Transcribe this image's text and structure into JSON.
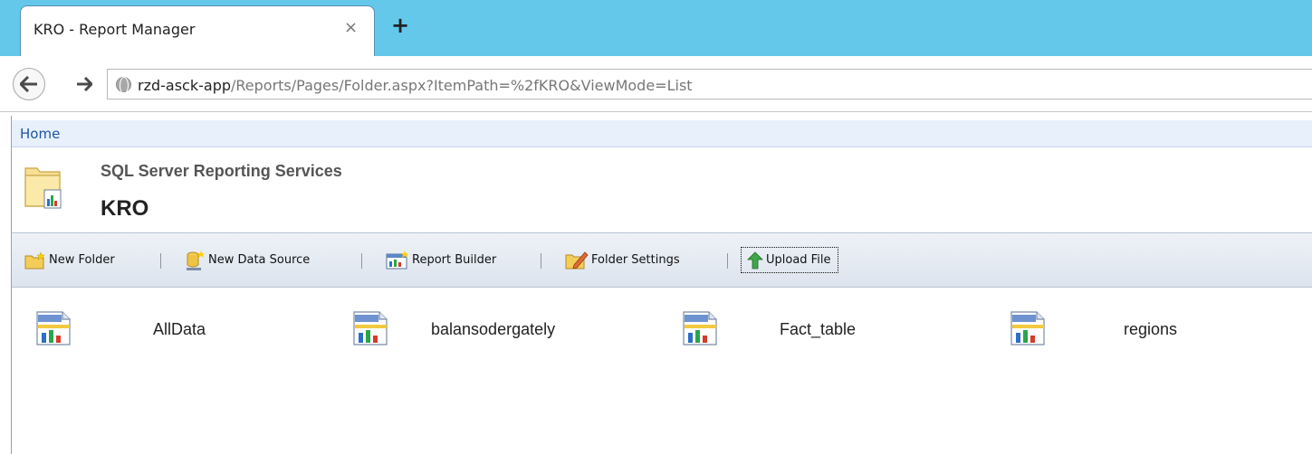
{
  "browser": {
    "tab_title": "KRO - Report Manager",
    "tab_close": "×",
    "new_tab": "+",
    "url_host": "rzd-asck-app",
    "url_path": "/Reports/Pages/Folder.aspx?ItemPath=%2fKRO&ViewMode=List"
  },
  "breadcrumb": {
    "home": "Home"
  },
  "header": {
    "app_title": "SQL Server Reporting Services",
    "folder_title": "KRO"
  },
  "toolbar": {
    "new_folder": "New Folder",
    "new_data_source": "New Data Source",
    "report_builder": "Report Builder",
    "folder_settings": "Folder Settings",
    "upload_file": "Upload File"
  },
  "items": [
    {
      "name": "AllData",
      "icon": "report-icon"
    },
    {
      "name": "balansodergately",
      "icon": "report-icon"
    },
    {
      "name": "Fact_table",
      "icon": "report-icon"
    },
    {
      "name": "regions",
      "icon": "report-icon"
    }
  ],
  "colors": {
    "tabstrip": "#63c8ea",
    "breadcrumb_bg": "#e8f0fb",
    "link": "#1e55a3",
    "toolbar_top": "#eef2f7",
    "toolbar_bottom": "#dde4ee"
  }
}
